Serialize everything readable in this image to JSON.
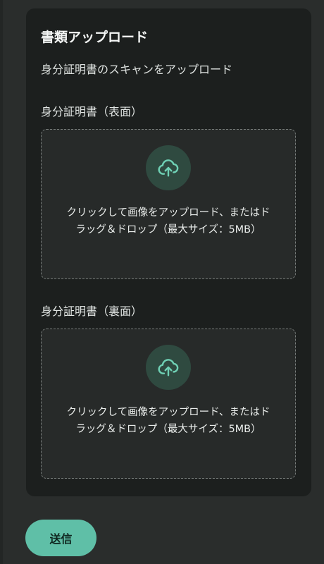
{
  "card": {
    "title": "書類アップロード",
    "subtitle": "身分証明書のスキャンをアップロード"
  },
  "uploads": [
    {
      "label": "身分証明書（表面）",
      "icon": "cloud-upload-icon",
      "instruction": "クリックして画像をアップロード、またはドラッグ＆ドロップ（最大サイズ：5MB）"
    },
    {
      "label": "身分証明書（裏面）",
      "icon": "cloud-upload-icon",
      "instruction": "クリックして画像をアップロード、またはドラッグ＆ドロップ（最大サイズ：5MB）"
    }
  ],
  "submit": {
    "label": "送信"
  },
  "colors": {
    "accent": "#5fbfa7",
    "card_background": "#1c1f1e",
    "page_background": "#2a2d2c",
    "icon_circle": "#2f4a40",
    "icon_stroke": "#6fd0b4"
  }
}
